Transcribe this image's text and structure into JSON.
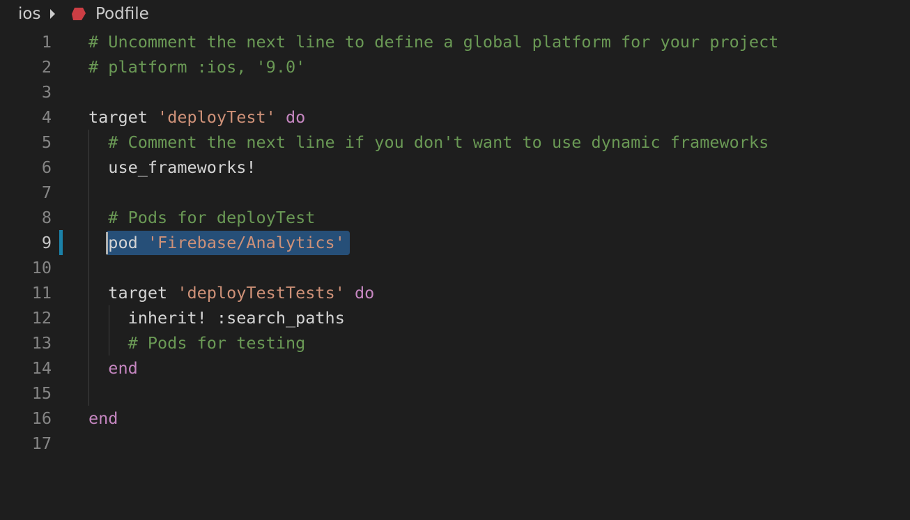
{
  "breadcrumb": {
    "folder": "ios",
    "file": "Podfile",
    "file_icon": "ruby-icon"
  },
  "colors": {
    "background": "#1e1e1e",
    "comment": "#6a9955",
    "string": "#ce9178",
    "keyword": "#c586c0",
    "selection": "#264f78",
    "modified_gutter": "#1b81a8"
  },
  "editor": {
    "active_line": 9,
    "selected_text": "pod 'Firebase/Analytics'",
    "lines": [
      {
        "n": "1",
        "tokens": [
          {
            "t": "# Uncomment the next line to define a global platform for your project",
            "c": "comment"
          }
        ]
      },
      {
        "n": "2",
        "tokens": [
          {
            "t": "# platform :ios, '9.0'",
            "c": "comment"
          }
        ]
      },
      {
        "n": "3",
        "tokens": []
      },
      {
        "n": "4",
        "tokens": [
          {
            "t": "target ",
            "c": "plain"
          },
          {
            "t": "'deployTest'",
            "c": "string"
          },
          {
            "t": " do",
            "c": "keyword"
          }
        ]
      },
      {
        "n": "5",
        "tokens": [
          {
            "t": "  ",
            "c": "plain"
          },
          {
            "t": "# Comment the next line if you don't want to use dynamic frameworks",
            "c": "comment"
          }
        ]
      },
      {
        "n": "6",
        "tokens": [
          {
            "t": "  use_frameworks!",
            "c": "plain"
          }
        ]
      },
      {
        "n": "7",
        "tokens": []
      },
      {
        "n": "8",
        "tokens": [
          {
            "t": "  ",
            "c": "plain"
          },
          {
            "t": "# Pods for deployTest",
            "c": "comment"
          }
        ]
      },
      {
        "n": "9",
        "tokens": [
          {
            "t": "  pod ",
            "c": "plain"
          },
          {
            "t": "'Firebase/Analytics'",
            "c": "string"
          }
        ]
      },
      {
        "n": "10",
        "tokens": []
      },
      {
        "n": "11",
        "tokens": [
          {
            "t": "  target ",
            "c": "plain"
          },
          {
            "t": "'deployTestTests'",
            "c": "string"
          },
          {
            "t": " do",
            "c": "keyword"
          }
        ]
      },
      {
        "n": "12",
        "tokens": [
          {
            "t": "    inherit! :search_paths",
            "c": "plain"
          }
        ]
      },
      {
        "n": "13",
        "tokens": [
          {
            "t": "    ",
            "c": "plain"
          },
          {
            "t": "# Pods for testing",
            "c": "comment"
          }
        ]
      },
      {
        "n": "14",
        "tokens": [
          {
            "t": "  ",
            "c": "plain"
          },
          {
            "t": "end",
            "c": "keyword"
          }
        ]
      },
      {
        "n": "15",
        "tokens": []
      },
      {
        "n": "16",
        "tokens": [
          {
            "t": "end",
            "c": "keyword"
          }
        ]
      },
      {
        "n": "17",
        "tokens": []
      }
    ]
  }
}
